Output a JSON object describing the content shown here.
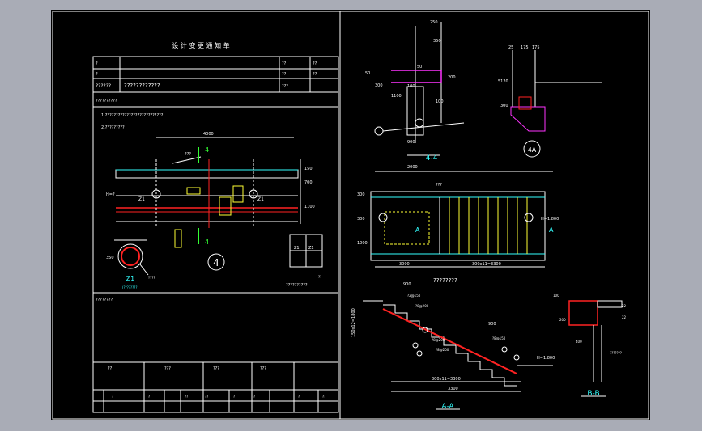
{
  "form": {
    "title": "设 计 变 更 通 知 单",
    "row1_q": "?",
    "row1_a": "??",
    "row1_b": "??",
    "row2_q": "?",
    "row2_a": "??",
    "row2_b": "??",
    "row3_label": "??????",
    "row3_value": "????????????",
    "row3_b": "???",
    "row4_label": "??????????",
    "line1": "1.???????????????????????????",
    "line2": "2.?????????",
    "footer_label": "????????",
    "sign_cols": [
      "??",
      "???",
      "???",
      "???"
    ],
    "bottom_cols": [
      "?",
      "?",
      "??",
      "??",
      "?",
      "?",
      "?",
      "??"
    ]
  },
  "plan4": {
    "dim_top": "4000",
    "label": "???",
    "h_left": "H=?",
    "z1_a": "Z1",
    "z1_b": "Z1",
    "dim_right_a": "150",
    "dim_right_b": "700",
    "dim_right_c": "1100",
    "section_num": "4",
    "marker": "4"
  },
  "z1": {
    "title": "Z1",
    "sub": "(????????)",
    "dim": "350",
    "note": "????"
  },
  "detail_small": {
    "l1": "Z1",
    "l2": "Z1",
    "caption": "??????????",
    "dim": "??"
  },
  "sec44": {
    "title": "4-4",
    "dims": [
      "250",
      "350",
      "50",
      "200",
      "100",
      "1100",
      "50",
      "900",
      "300",
      "100"
    ],
    "marker": "?"
  },
  "sec4a": {
    "title": "4A",
    "dims": [
      "25",
      "175",
      "175",
      "5120",
      "300"
    ]
  },
  "plan_stair": {
    "dim_top": "2000",
    "label": "???",
    "h": "H=1.800",
    "dim_bottom_a": "3000",
    "dim_bottom_b": "300x11=3300",
    "caption": "????????",
    "mark_a": "A",
    "mark_a2": "A",
    "dims_left": [
      "300",
      "300",
      "1000"
    ]
  },
  "secAA": {
    "title": "A-A",
    "dim_top": "900",
    "dim_mid": "900",
    "dim_bottom_a": "300x11=3300",
    "dim_bottom_b": "3300",
    "left_dim": "150x12=1800",
    "h": "H=1.800",
    "notes": [
      "?2@150",
      "?8@200",
      "?8@200",
      "?8@200",
      "?8@150"
    ],
    "circles": [
      "1",
      "2",
      "3",
      "4",
      "5"
    ]
  },
  "secBB": {
    "title": "B-B",
    "dims": [
      "100",
      "22",
      "200",
      "400",
      "22"
    ],
    "note": "???????"
  },
  "colors": {
    "background": "#a9acb6",
    "sheet": "#000000",
    "line_white": "#ffffff",
    "line_yellow": "#ffff33",
    "line_green": "#33ff33",
    "line_cyan": "#33ffff",
    "line_red": "#ff2222",
    "line_magenta": "#ff33ff"
  }
}
